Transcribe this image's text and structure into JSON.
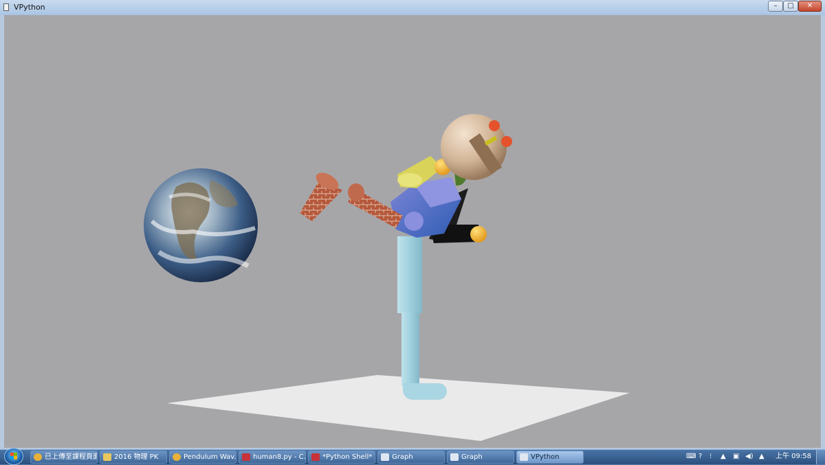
{
  "window": {
    "title": "VPython",
    "min_label": "–",
    "max_label": "□",
    "close_label": "✕"
  },
  "scene": {
    "background": "#a6a6a9",
    "objects": {
      "earth_sphere": "earth-textured sphere",
      "ground_plane": "white floor plate",
      "robot_figure": "figure built from boxes, cylinders and spheres kicking toward the ball"
    }
  },
  "taskbar": {
    "items": [
      {
        "label": "已上傳至課程頁面 - Google Chrome",
        "icon": "chrome-icon",
        "color": "#e8b23a"
      },
      {
        "label": "2016 物理 PK",
        "icon": "folder-icon",
        "color": "#e9c75c"
      },
      {
        "label": "Pendulum Wav...",
        "icon": "chrome-icon",
        "color": "#e8b23a"
      },
      {
        "label": "human8.py - C...",
        "icon": "idle-icon",
        "color": "#c8323a"
      },
      {
        "label": "*Python Shell*",
        "icon": "idle-icon",
        "color": "#c8323a"
      },
      {
        "label": "Graph",
        "icon": "window-icon",
        "color": "#dfe7f2"
      },
      {
        "label": "Graph",
        "icon": "window-icon",
        "color": "#dfe7f2"
      },
      {
        "label": "VPython",
        "icon": "window-icon",
        "color": "#dfe7f2"
      }
    ],
    "tray": {
      "clock": "上午 09:58",
      "icons": [
        "keyboard-icon",
        "help-icon",
        "network-icon",
        "volume-icon",
        "flag-icon"
      ]
    }
  }
}
